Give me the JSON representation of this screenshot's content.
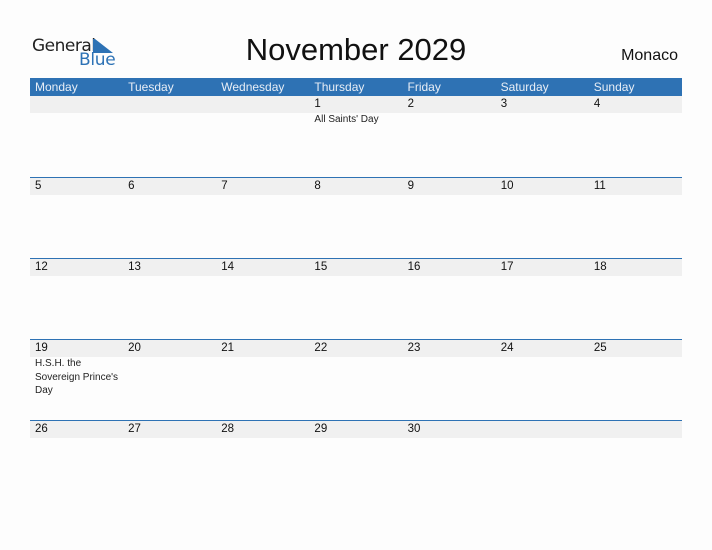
{
  "logo": {
    "general": "General",
    "blue": "Blue"
  },
  "title": "November 2029",
  "country": "Monaco",
  "weekdays": [
    "Monday",
    "Tuesday",
    "Wednesday",
    "Thursday",
    "Friday",
    "Saturday",
    "Sunday"
  ],
  "weeks": [
    [
      {
        "day": ""
      },
      {
        "day": ""
      },
      {
        "day": ""
      },
      {
        "day": "1",
        "holiday": "All Saints' Day"
      },
      {
        "day": "2"
      },
      {
        "day": "3"
      },
      {
        "day": "4"
      }
    ],
    [
      {
        "day": "5"
      },
      {
        "day": "6"
      },
      {
        "day": "7"
      },
      {
        "day": "8"
      },
      {
        "day": "9"
      },
      {
        "day": "10"
      },
      {
        "day": "11"
      }
    ],
    [
      {
        "day": "12"
      },
      {
        "day": "13"
      },
      {
        "day": "14"
      },
      {
        "day": "15"
      },
      {
        "day": "16"
      },
      {
        "day": "17"
      },
      {
        "day": "18"
      }
    ],
    [
      {
        "day": "19",
        "holiday": "H.S.H. the Sovereign Prince's Day"
      },
      {
        "day": "20"
      },
      {
        "day": "21"
      },
      {
        "day": "22"
      },
      {
        "day": "23"
      },
      {
        "day": "24"
      },
      {
        "day": "25"
      }
    ],
    [
      {
        "day": "26"
      },
      {
        "day": "27"
      },
      {
        "day": "28"
      },
      {
        "day": "29"
      },
      {
        "day": "30"
      },
      {
        "day": ""
      },
      {
        "day": ""
      }
    ]
  ],
  "colors": {
    "accent": "#2e72b4",
    "dayBar": "#f0f0f0"
  }
}
